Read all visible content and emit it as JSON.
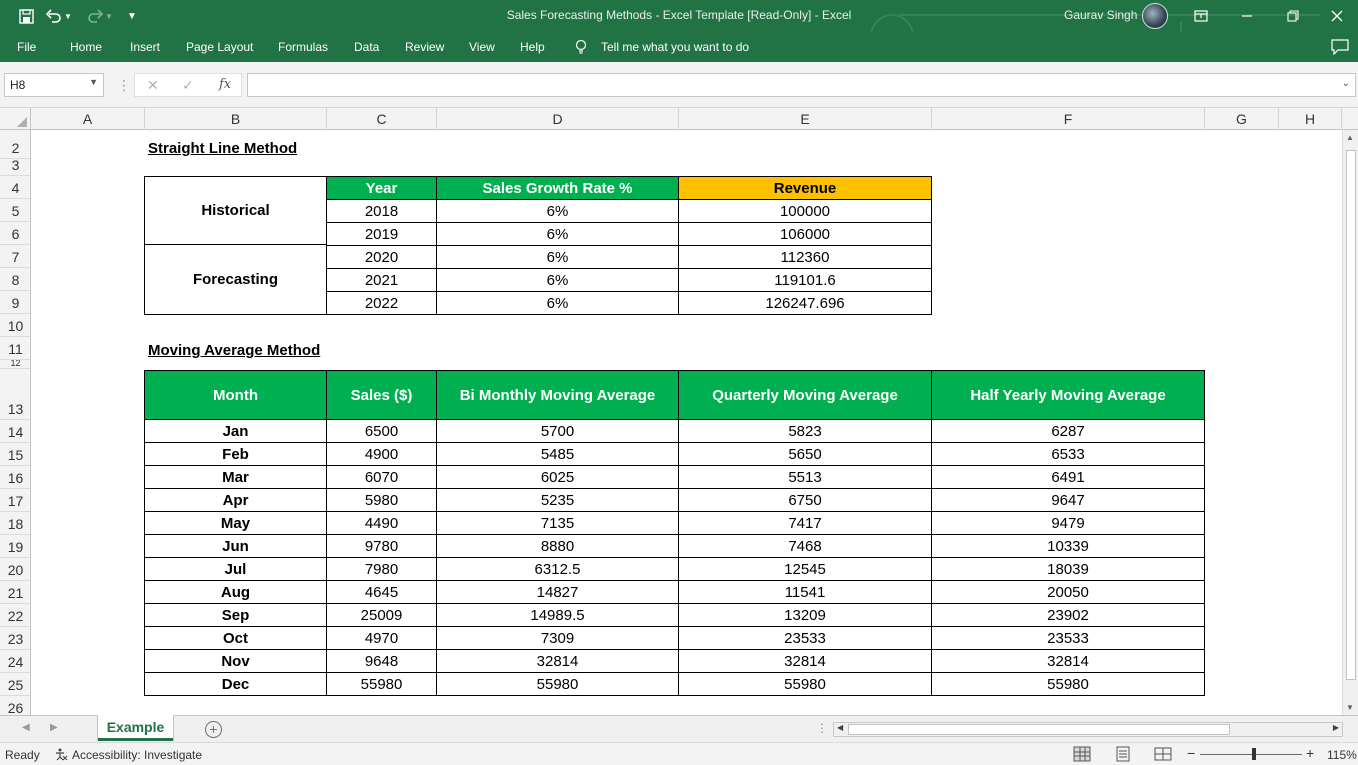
{
  "window": {
    "title": "Sales Forecasting Methods - Excel Template  [Read-Only]  -  Excel",
    "user": "Gaurav Singh"
  },
  "ribbon_tabs": [
    "File",
    "Home",
    "Insert",
    "Page Layout",
    "Formulas",
    "Data",
    "Review",
    "View",
    "Help"
  ],
  "tell_me": "Tell me what you want to do",
  "formula_bar": {
    "name_box": "H8",
    "formula": ""
  },
  "columns": [
    "A",
    "B",
    "C",
    "D",
    "E",
    "F",
    "G",
    "H"
  ],
  "rows": [
    "2",
    "3",
    "4",
    "5",
    "6",
    "7",
    "8",
    "9",
    "10",
    "11",
    "12",
    "13",
    "14",
    "15",
    "16",
    "17",
    "18",
    "19",
    "20",
    "21",
    "22",
    "23",
    "24",
    "25",
    "26"
  ],
  "straight_line": {
    "title": "Straight Line Method",
    "headers": [
      "Year",
      "Sales Growth Rate %",
      "Revenue"
    ],
    "group_historical": "Historical",
    "group_forecasting": "Forecasting",
    "rows": [
      {
        "year": "2018",
        "rate": "6%",
        "revenue": "100000"
      },
      {
        "year": "2019",
        "rate": "6%",
        "revenue": "106000"
      },
      {
        "year": "2020",
        "rate": "6%",
        "revenue": "112360"
      },
      {
        "year": "2021",
        "rate": "6%",
        "revenue": "119101.6"
      },
      {
        "year": "2022",
        "rate": "6%",
        "revenue": "126247.696"
      }
    ]
  },
  "moving_average": {
    "title": "Moving Average Method",
    "headers": [
      "Month",
      "Sales ($)",
      "Bi Monthly Moving Average",
      "Quarterly Moving Average",
      "Half Yearly Moving Average"
    ],
    "rows": [
      [
        "Jan",
        "6500",
        "5700",
        "5823",
        "6287"
      ],
      [
        "Feb",
        "4900",
        "5485",
        "5650",
        "6533"
      ],
      [
        "Mar",
        "6070",
        "6025",
        "5513",
        "6491"
      ],
      [
        "Apr",
        "5980",
        "5235",
        "6750",
        "9647"
      ],
      [
        "May",
        "4490",
        "7135",
        "7417",
        "9479"
      ],
      [
        "Jun",
        "9780",
        "8880",
        "7468",
        "10339"
      ],
      [
        "Jul",
        "7980",
        "6312.5",
        "12545",
        "18039"
      ],
      [
        "Aug",
        "4645",
        "14827",
        "11541",
        "20050"
      ],
      [
        "Sep",
        "25009",
        "14989.5",
        "13209",
        "23902"
      ],
      [
        "Oct",
        "4970",
        "7309",
        "23533",
        "23533"
      ],
      [
        "Nov",
        "9648",
        "32814",
        "32814",
        "32814"
      ],
      [
        "Dec",
        "55980",
        "55980",
        "55980",
        "55980"
      ]
    ]
  },
  "sheet_tabs": [
    "Example"
  ],
  "status": {
    "ready": "Ready",
    "accessibility": "Accessibility: Investigate",
    "zoom": "115%"
  },
  "colors": {
    "excel_green": "#217346",
    "header_green": "#00b050",
    "header_gold": "#ffc000"
  }
}
